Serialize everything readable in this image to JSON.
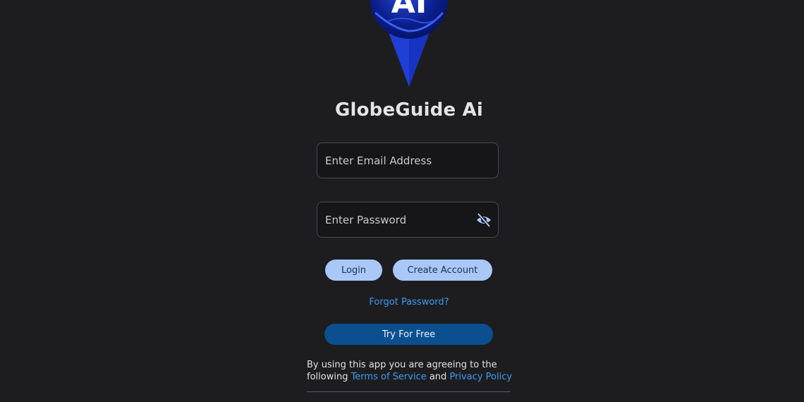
{
  "logo": {
    "text": "AI",
    "icon": "globe-pin-icon",
    "colors": {
      "pin": "#1f3fd6",
      "globe": "#0a1f8c",
      "highlight": "#3f5ff0"
    }
  },
  "app": {
    "title": "GlobeGuide Ai"
  },
  "form": {
    "email_placeholder": "Enter Email Address",
    "password_placeholder": "Enter Password",
    "password_toggle_icon": "eye-off-icon"
  },
  "actions": {
    "login_label": "Login",
    "create_account_label": "Create Account",
    "forgot_password_label": "Forgot Password?",
    "try_free_label": "Try For Free"
  },
  "legal": {
    "line1": "By using this app you are agreeing to the",
    "line2_prefix": "following ",
    "terms_label": "Terms of Service",
    "and": " and ",
    "privacy_label": "Privacy Policy"
  },
  "colors": {
    "background": "#1d1d20",
    "primary_button": "#a9c8f7",
    "accent_button": "#0b4f8f",
    "link": "#3d9cf0"
  }
}
